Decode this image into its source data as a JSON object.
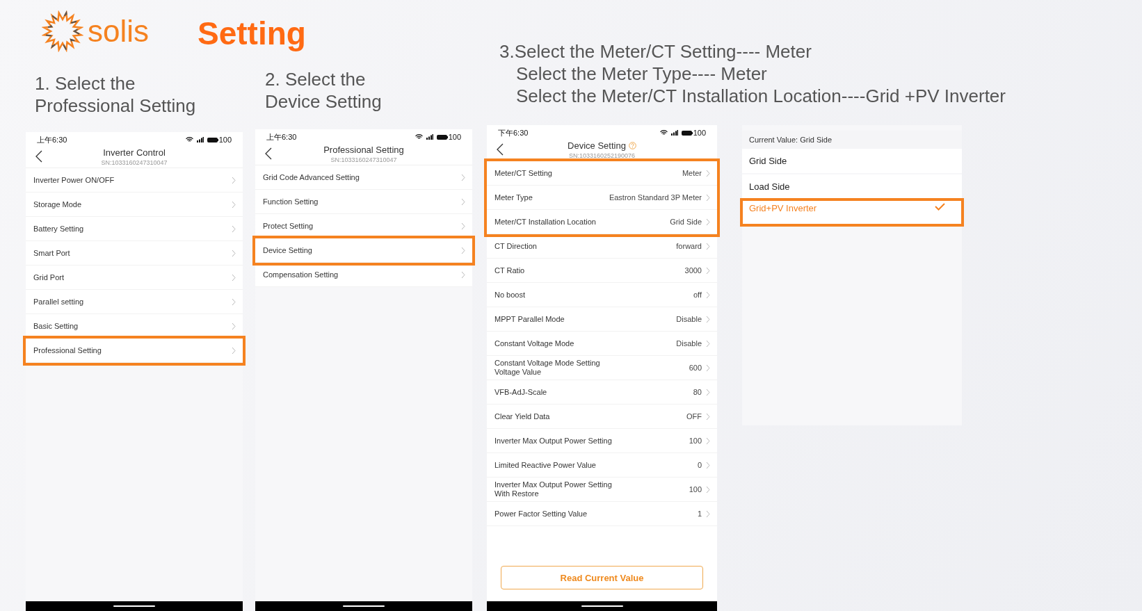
{
  "logo": {
    "text": "solis"
  },
  "title": "Setting",
  "steps": [
    {
      "lines": [
        "1. Select the",
        "Professional Setting"
      ],
      "hanging_indent": false
    },
    {
      "lines": [
        "2. Select the",
        "Device Setting"
      ],
      "hanging_indent": false
    },
    {
      "lines": [
        "3.Select the Meter/CT Setting---- Meter",
        "Select the Meter Type---- Meter",
        "Select the Meter/CT Installation Location----Grid +PV Inverter"
      ],
      "hanging_indent": true
    }
  ],
  "screens": [
    {
      "kind": "phone",
      "status": {
        "time": "上午6:30",
        "battery": "100"
      },
      "title": "Inverter Control",
      "serial": "SN:1033160247310047",
      "help": false,
      "rows": [
        {
          "label": "Inverter Power ON/OFF",
          "highlighted": false
        },
        {
          "label": "Storage Mode",
          "highlighted": false
        },
        {
          "label": "Battery Setting",
          "highlighted": false
        },
        {
          "label": "Smart Port",
          "highlighted": false
        },
        {
          "label": "Grid Port",
          "highlighted": false
        },
        {
          "label": "Parallel setting",
          "highlighted": false
        },
        {
          "label": "Basic Setting",
          "highlighted": false
        },
        {
          "label": "Professional Setting",
          "highlighted": true
        }
      ]
    },
    {
      "kind": "phone",
      "status": {
        "time": "上午6:30",
        "battery": "100"
      },
      "title": "Professional Setting",
      "serial": "SN:1033160247310047",
      "help": false,
      "rows": [
        {
          "label": "Grid Code Advanced Setting",
          "highlighted": false
        },
        {
          "label": "Function Setting",
          "highlighted": false
        },
        {
          "label": "Protect Setting",
          "highlighted": false
        },
        {
          "label": "Device Setting",
          "highlighted": true
        },
        {
          "label": "Compensation Setting",
          "highlighted": false
        }
      ]
    },
    {
      "kind": "phone",
      "status": {
        "time": "下午6:30",
        "battery": "100"
      },
      "title": "Device Setting",
      "serial": "SN:1033160252190076",
      "help": true,
      "rows": [
        {
          "label": "Meter/CT Setting",
          "value": "Meter",
          "highlighted": true
        },
        {
          "label": "Meter Type",
          "value": "Eastron Standard 3P Meter",
          "highlighted": true
        },
        {
          "label": "Meter/CT Installation Location",
          "value": "Grid Side",
          "highlighted": true
        },
        {
          "label": "CT Direction",
          "value": "forward",
          "highlighted": false
        },
        {
          "label": "CT Ratio",
          "value": "3000",
          "highlighted": false
        },
        {
          "label": "No boost",
          "value": "off",
          "highlighted": false
        },
        {
          "label": "MPPT Parallel Mode",
          "value": "Disable",
          "highlighted": false
        },
        {
          "label": "Constant Voltage Mode",
          "value": "Disable",
          "highlighted": false
        },
        {
          "label": "Constant Voltage Mode Setting Voltage Value",
          "value": "600",
          "highlighted": false
        },
        {
          "label": "VFB-AdJ-Scale",
          "value": "80",
          "highlighted": false
        },
        {
          "label": "Clear Yield Data",
          "value": "OFF",
          "highlighted": false
        },
        {
          "label": "Inverter Max Output Power Setting",
          "value": "100",
          "highlighted": false
        },
        {
          "label": "Limited Reactive Power Value",
          "value": "0",
          "highlighted": false
        },
        {
          "label": "Inverter Max Output Power Setting With Restore",
          "value": "100",
          "highlighted": false
        },
        {
          "label": "Power Factor Setting Value",
          "value": "1",
          "highlighted": false
        }
      ],
      "action_button": "Read Current Value"
    },
    {
      "kind": "options",
      "current": "Current Value: Grid Side",
      "options": [
        {
          "label": "Grid Side",
          "selected": false,
          "highlighted": false
        },
        {
          "label": "Load Side",
          "selected": false,
          "highlighted": false
        },
        {
          "label": "Grid+PV Inverter",
          "selected": true,
          "highlighted": true
        }
      ]
    }
  ]
}
